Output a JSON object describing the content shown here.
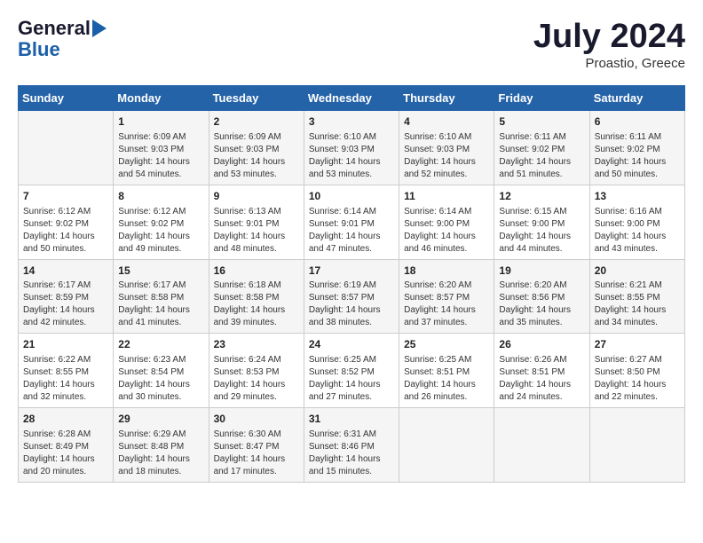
{
  "header": {
    "logo_line1": "General",
    "logo_line2": "Blue",
    "month_year": "July 2024",
    "location": "Proastio, Greece"
  },
  "weekdays": [
    "Sunday",
    "Monday",
    "Tuesday",
    "Wednesday",
    "Thursday",
    "Friday",
    "Saturday"
  ],
  "weeks": [
    [
      {
        "day": "",
        "content": ""
      },
      {
        "day": "1",
        "content": "Sunrise: 6:09 AM\nSunset: 9:03 PM\nDaylight: 14 hours\nand 54 minutes."
      },
      {
        "day": "2",
        "content": "Sunrise: 6:09 AM\nSunset: 9:03 PM\nDaylight: 14 hours\nand 53 minutes."
      },
      {
        "day": "3",
        "content": "Sunrise: 6:10 AM\nSunset: 9:03 PM\nDaylight: 14 hours\nand 53 minutes."
      },
      {
        "day": "4",
        "content": "Sunrise: 6:10 AM\nSunset: 9:03 PM\nDaylight: 14 hours\nand 52 minutes."
      },
      {
        "day": "5",
        "content": "Sunrise: 6:11 AM\nSunset: 9:02 PM\nDaylight: 14 hours\nand 51 minutes."
      },
      {
        "day": "6",
        "content": "Sunrise: 6:11 AM\nSunset: 9:02 PM\nDaylight: 14 hours\nand 50 minutes."
      }
    ],
    [
      {
        "day": "7",
        "content": "Sunrise: 6:12 AM\nSunset: 9:02 PM\nDaylight: 14 hours\nand 50 minutes."
      },
      {
        "day": "8",
        "content": "Sunrise: 6:12 AM\nSunset: 9:02 PM\nDaylight: 14 hours\nand 49 minutes."
      },
      {
        "day": "9",
        "content": "Sunrise: 6:13 AM\nSunset: 9:01 PM\nDaylight: 14 hours\nand 48 minutes."
      },
      {
        "day": "10",
        "content": "Sunrise: 6:14 AM\nSunset: 9:01 PM\nDaylight: 14 hours\nand 47 minutes."
      },
      {
        "day": "11",
        "content": "Sunrise: 6:14 AM\nSunset: 9:00 PM\nDaylight: 14 hours\nand 46 minutes."
      },
      {
        "day": "12",
        "content": "Sunrise: 6:15 AM\nSunset: 9:00 PM\nDaylight: 14 hours\nand 44 minutes."
      },
      {
        "day": "13",
        "content": "Sunrise: 6:16 AM\nSunset: 9:00 PM\nDaylight: 14 hours\nand 43 minutes."
      }
    ],
    [
      {
        "day": "14",
        "content": "Sunrise: 6:17 AM\nSunset: 8:59 PM\nDaylight: 14 hours\nand 42 minutes."
      },
      {
        "day": "15",
        "content": "Sunrise: 6:17 AM\nSunset: 8:58 PM\nDaylight: 14 hours\nand 41 minutes."
      },
      {
        "day": "16",
        "content": "Sunrise: 6:18 AM\nSunset: 8:58 PM\nDaylight: 14 hours\nand 39 minutes."
      },
      {
        "day": "17",
        "content": "Sunrise: 6:19 AM\nSunset: 8:57 PM\nDaylight: 14 hours\nand 38 minutes."
      },
      {
        "day": "18",
        "content": "Sunrise: 6:20 AM\nSunset: 8:57 PM\nDaylight: 14 hours\nand 37 minutes."
      },
      {
        "day": "19",
        "content": "Sunrise: 6:20 AM\nSunset: 8:56 PM\nDaylight: 14 hours\nand 35 minutes."
      },
      {
        "day": "20",
        "content": "Sunrise: 6:21 AM\nSunset: 8:55 PM\nDaylight: 14 hours\nand 34 minutes."
      }
    ],
    [
      {
        "day": "21",
        "content": "Sunrise: 6:22 AM\nSunset: 8:55 PM\nDaylight: 14 hours\nand 32 minutes."
      },
      {
        "day": "22",
        "content": "Sunrise: 6:23 AM\nSunset: 8:54 PM\nDaylight: 14 hours\nand 30 minutes."
      },
      {
        "day": "23",
        "content": "Sunrise: 6:24 AM\nSunset: 8:53 PM\nDaylight: 14 hours\nand 29 minutes."
      },
      {
        "day": "24",
        "content": "Sunrise: 6:25 AM\nSunset: 8:52 PM\nDaylight: 14 hours\nand 27 minutes."
      },
      {
        "day": "25",
        "content": "Sunrise: 6:25 AM\nSunset: 8:51 PM\nDaylight: 14 hours\nand 26 minutes."
      },
      {
        "day": "26",
        "content": "Sunrise: 6:26 AM\nSunset: 8:51 PM\nDaylight: 14 hours\nand 24 minutes."
      },
      {
        "day": "27",
        "content": "Sunrise: 6:27 AM\nSunset: 8:50 PM\nDaylight: 14 hours\nand 22 minutes."
      }
    ],
    [
      {
        "day": "28",
        "content": "Sunrise: 6:28 AM\nSunset: 8:49 PM\nDaylight: 14 hours\nand 20 minutes."
      },
      {
        "day": "29",
        "content": "Sunrise: 6:29 AM\nSunset: 8:48 PM\nDaylight: 14 hours\nand 18 minutes."
      },
      {
        "day": "30",
        "content": "Sunrise: 6:30 AM\nSunset: 8:47 PM\nDaylight: 14 hours\nand 17 minutes."
      },
      {
        "day": "31",
        "content": "Sunrise: 6:31 AM\nSunset: 8:46 PM\nDaylight: 14 hours\nand 15 minutes."
      },
      {
        "day": "",
        "content": ""
      },
      {
        "day": "",
        "content": ""
      },
      {
        "day": "",
        "content": ""
      }
    ]
  ]
}
